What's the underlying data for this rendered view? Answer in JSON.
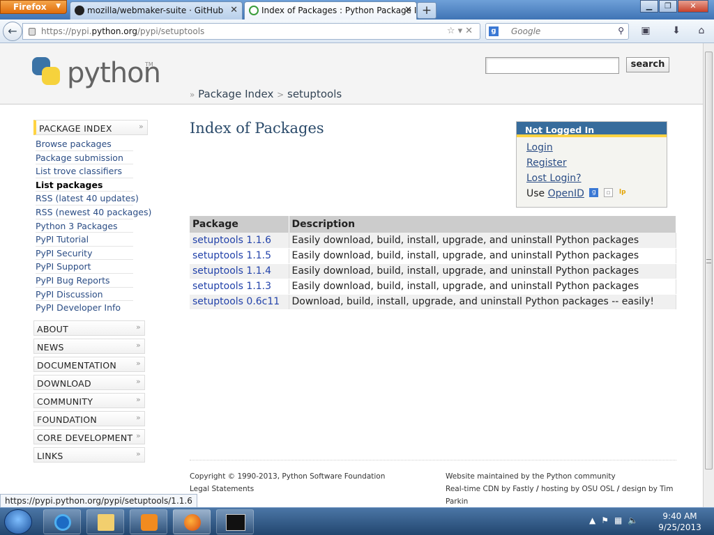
{
  "browser": {
    "menu_label": "Firefox",
    "tabs": [
      {
        "label": "mozilla/webmaker-suite · GitHub"
      },
      {
        "label": "Index of Packages : Python Package I..."
      }
    ],
    "url_prefix": "https://pypi.",
    "url_domain": "python.org",
    "url_path": "/pypi/setuptools",
    "search_placeholder": "Google",
    "status_url": "https://pypi.python.org/pypi/setuptools/1.1.6"
  },
  "header": {
    "logo_text": "python",
    "logo_tm": "TM",
    "search_button": "search",
    "breadcrumb": {
      "marker": "»",
      "item1": "Package Index",
      "sep": ">",
      "item2": "setuptools"
    }
  },
  "sidebar": {
    "heading": "PACKAGE INDEX",
    "items": [
      {
        "label": "Browse packages"
      },
      {
        "label": "Package submission"
      },
      {
        "label": "List trove classifiers"
      },
      {
        "label": "List packages"
      },
      {
        "label": "RSS (latest 40 updates)"
      },
      {
        "label": "RSS (newest 40 packages)"
      },
      {
        "label": "Python 3 Packages"
      },
      {
        "label": "PyPI Tutorial"
      },
      {
        "label": "PyPI Security"
      },
      {
        "label": "PyPI Support"
      },
      {
        "label": "PyPI Bug Reports"
      },
      {
        "label": "PyPI Discussion"
      },
      {
        "label": "PyPI Developer Info"
      }
    ],
    "sections": [
      {
        "label": "ABOUT"
      },
      {
        "label": "NEWS"
      },
      {
        "label": "DOCUMENTATION"
      },
      {
        "label": "DOWNLOAD"
      },
      {
        "label": "COMMUNITY"
      },
      {
        "label": "FOUNDATION"
      },
      {
        "label": "CORE DEVELOPMENT"
      },
      {
        "label": "LINKS"
      }
    ]
  },
  "main": {
    "title": "Index of Packages",
    "login": {
      "heading": "Not Logged In",
      "login": "Login",
      "register": "Register",
      "lost": "Lost Login?",
      "use": "Use",
      "openid": "OpenID"
    },
    "table": {
      "col_package": "Package",
      "col_description": "Description",
      "rows": [
        {
          "name": "setuptools 1.1.6",
          "desc": "Easily download, build, install, upgrade, and uninstall Python packages"
        },
        {
          "name": "setuptools 1.1.5",
          "desc": "Easily download, build, install, upgrade, and uninstall Python packages"
        },
        {
          "name": "setuptools 1.1.4",
          "desc": "Easily download, build, install, upgrade, and uninstall Python packages"
        },
        {
          "name": "setuptools 1.1.3",
          "desc": "Easily download, build, install, upgrade, and uninstall Python packages"
        },
        {
          "name": "setuptools 0.6c11",
          "desc": "Download, build, install, upgrade, and uninstall Python packages -- easily!"
        }
      ]
    }
  },
  "footer": {
    "copyright": "Copyright © 1990-2013,",
    "psf": "Python Software Foundation",
    "legal": "Legal Statements",
    "maintained": "Website maintained by the Python community",
    "cdn": "Real-time CDN by Fastly",
    "hosting": "hosting by OSU OSL",
    "design": "design by Tim Parkin",
    "slash": "/"
  },
  "taskbar": {
    "time": "9:40 AM",
    "date": "9/25/2013"
  }
}
